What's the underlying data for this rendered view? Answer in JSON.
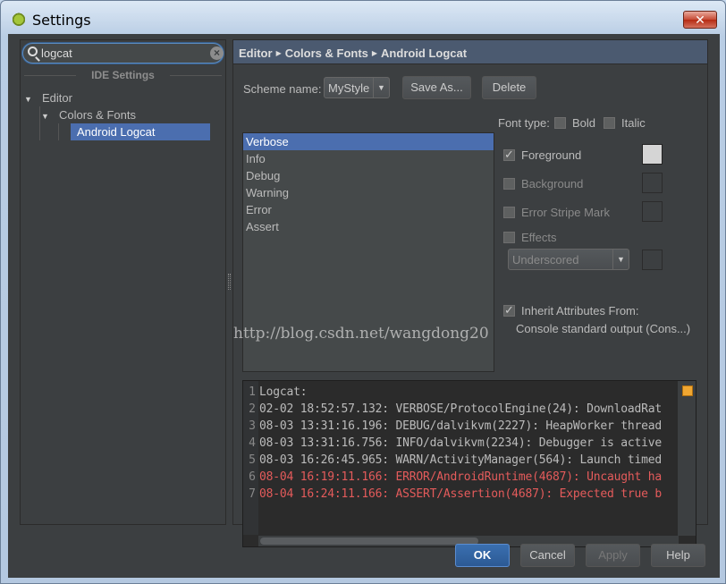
{
  "window": {
    "title": "Settings",
    "close_glyph": "✕"
  },
  "search": {
    "value": "logcat",
    "clear_glyph": "×"
  },
  "sidebar": {
    "section_title": "IDE Settings",
    "items": [
      {
        "label": "Editor",
        "arrow": "▼"
      },
      {
        "label": "Colors & Fonts",
        "arrow": "▼"
      },
      {
        "label": "Android Logcat"
      }
    ]
  },
  "breadcrumb": {
    "parts": [
      "Editor",
      "Colors & Fonts",
      "Android Logcat"
    ],
    "separator": "▶"
  },
  "scheme": {
    "label": "Scheme name:",
    "selected": "MyStyle",
    "arrow": "▼",
    "save_as_label": "Save As...",
    "delete_label": "Delete"
  },
  "log_levels": [
    "Verbose",
    "Info",
    "Debug",
    "Warning",
    "Error",
    "Assert"
  ],
  "font_type": {
    "label": "Font type:",
    "bold": "Bold",
    "italic": "Italic"
  },
  "attributes": {
    "foreground": "Foreground",
    "background": "Background",
    "error_stripe": "Error Stripe Mark",
    "effects": "Effects",
    "effect_type": "Underscored",
    "effect_arrow": "▼",
    "inherit_label": "Inherit Attributes From:",
    "inherit_source": "Console standard output (Cons...)"
  },
  "preview": {
    "lines": [
      {
        "n": "1",
        "text": "Logcat:"
      },
      {
        "n": "2",
        "text": "02-02 18:52:57.132: VERBOSE/ProtocolEngine(24): DownloadRat"
      },
      {
        "n": "3",
        "text": "08-03 13:31:16.196: DEBUG/dalvikvm(2227): HeapWorker thread"
      },
      {
        "n": "4",
        "text": "08-03 13:31:16.756: INFO/dalvikvm(2234): Debugger is active"
      },
      {
        "n": "5",
        "text": "08-03 16:26:45.965: WARN/ActivityManager(564): Launch timed"
      },
      {
        "n": "6",
        "text": "08-04 16:19:11.166: ERROR/AndroidRuntime(4687): Uncaught ha"
      },
      {
        "n": "7",
        "text": "08-04 16:24:11.166: ASSERT/Assertion(4687): Expected true b"
      }
    ]
  },
  "watermark": "http://blog.csdn.net/wangdong20",
  "footer": {
    "ok": "OK",
    "cancel": "Cancel",
    "apply": "Apply",
    "help": "Help"
  },
  "colors": {
    "accent": "#4b6eaf",
    "error_text": "#e45b5b",
    "foreground_swatch": "#d5d5d5",
    "marker": "#f0a732"
  }
}
